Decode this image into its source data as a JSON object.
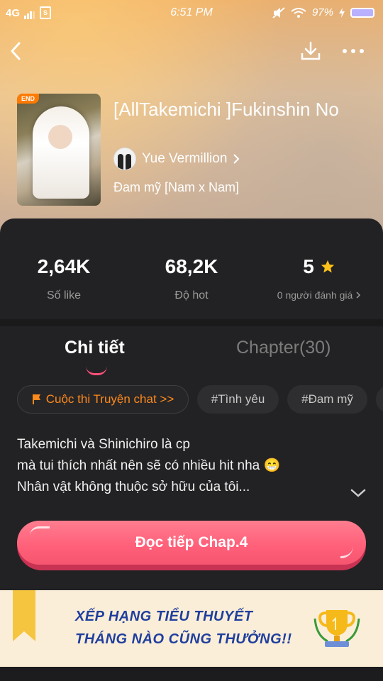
{
  "status_bar": {
    "network": "4G",
    "sim_label": "S",
    "time": "6:51 PM",
    "battery": "97%"
  },
  "book": {
    "cover_badge": "END",
    "title": "[AllTakemichi ]Fukinshin No",
    "author": "Yue Vermillion",
    "genre": "Đam mỹ [Nam x Nam]"
  },
  "stats": [
    {
      "value": "2,64K",
      "label": "Số like"
    },
    {
      "value": "68,2K",
      "label": "Độ hot"
    },
    {
      "value": "5",
      "label": "0 người đánh giá"
    }
  ],
  "tabs": [
    {
      "label": "Chi tiết",
      "active": true
    },
    {
      "label": "Chapter(30)",
      "active": false
    }
  ],
  "chips": [
    {
      "label": "Cuộc thi Truyện chat >>"
    },
    {
      "label": "#Tình yêu"
    },
    {
      "label": "#Đam mỹ"
    }
  ],
  "description": {
    "line1": "Takemichi và Shinichiro là cp",
    "line2": "mà tui thích nhất nên sẽ có nhiều hit nha 😁",
    "line3": "Nhân vật không thuộc sở hữu của tôi..."
  },
  "cta_label": "Đọc tiếp Chap.4",
  "banner": {
    "line1": "XẾP HẠNG TIỂU THUYẾT",
    "line2": "THÁNG NÀO CŨNG THƯỞNG!!"
  },
  "colors": {
    "accent": "#ff5f79",
    "contest": "#ff8a1c",
    "star": "#ffc21a",
    "panel": "#222224"
  },
  "icons": [
    "back-icon",
    "download-icon",
    "more-icon",
    "star-icon",
    "chevron-right-icon",
    "chevron-down-icon",
    "flag-icon",
    "trophy-icon"
  ]
}
